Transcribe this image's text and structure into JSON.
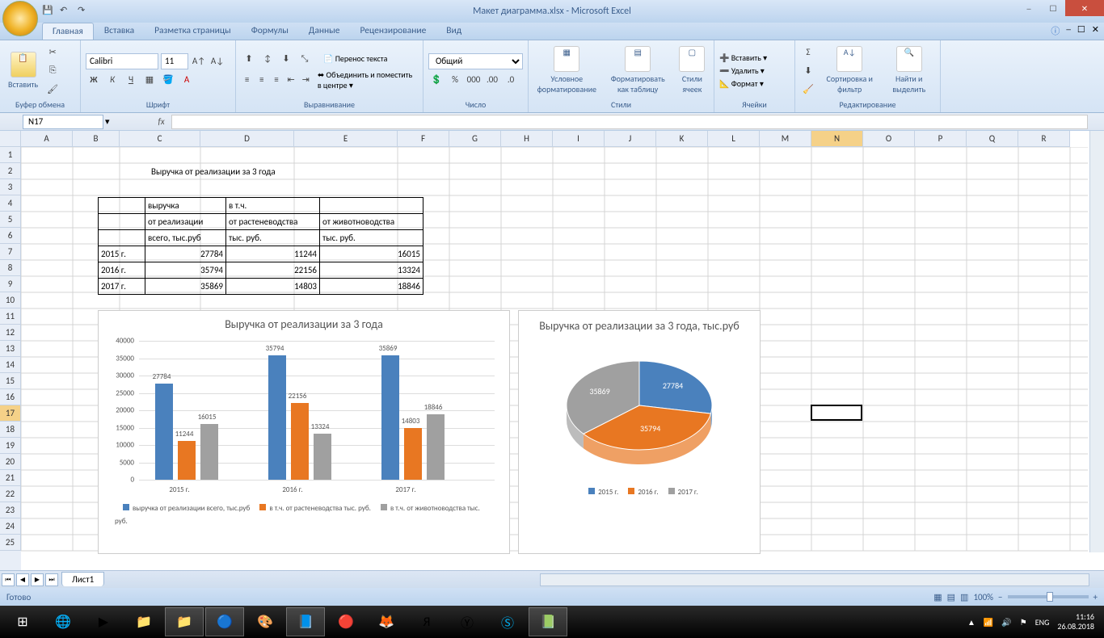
{
  "title": "Макет диаграмма.xlsx - Microsoft Excel",
  "tabs": [
    "Главная",
    "Вставка",
    "Разметка страницы",
    "Формулы",
    "Данные",
    "Рецензирование",
    "Вид"
  ],
  "ribbon": {
    "clipboard": {
      "paste": "Вставить",
      "label": "Буфер обмена"
    },
    "font": {
      "name": "Calibri",
      "size": "11",
      "label": "Шрифт",
      "bold": "Ж",
      "italic": "К",
      "underline": "Ч"
    },
    "align": {
      "wrap": "Перенос текста",
      "merge": "Объединить и поместить в центре",
      "label": "Выравнивание"
    },
    "number": {
      "format": "Общий",
      "label": "Число"
    },
    "styles": {
      "cond": "Условное форматирование",
      "table": "Форматировать как таблицу",
      "cell": "Стили ячеек",
      "label": "Стили"
    },
    "cells": {
      "insert": "Вставить",
      "delete": "Удалить",
      "format": "Формат",
      "label": "Ячейки"
    },
    "editing": {
      "sort": "Сортировка и фильтр",
      "find": "Найти и выделить",
      "label": "Редактирование"
    }
  },
  "namebox": "N17",
  "columns": [
    "A",
    "B",
    "C",
    "D",
    "E",
    "F",
    "G",
    "H",
    "I",
    "J",
    "K",
    "L",
    "M",
    "N",
    "O",
    "P",
    "Q",
    "R"
  ],
  "rows_count": 25,
  "col_widths": {
    "A": 64,
    "B": 58,
    "C": 100,
    "D": 116,
    "E": 128,
    "default": 64
  },
  "table_title": "Выручка от реализации за 3 года",
  "table": {
    "headers": [
      [
        "",
        "выручка",
        "в т.ч.",
        ""
      ],
      [
        "",
        "от реализации",
        "от растеневодства",
        "от животноводства"
      ],
      [
        "",
        "всего, тыс.руб",
        "тыс. руб.",
        "тыс. руб."
      ]
    ],
    "rows": [
      [
        "2015 г.",
        "27784",
        "11244",
        "16015"
      ],
      [
        "2016 г.",
        "35794",
        "22156",
        "13324"
      ],
      [
        "2017 г.",
        "35869",
        "14803",
        "18846"
      ]
    ]
  },
  "chart_data": [
    {
      "type": "bar",
      "title": "Выручка от реализации за 3 года",
      "categories": [
        "2015 г.",
        "2016 г.",
        "2017 г."
      ],
      "series": [
        {
          "name": "выручка  от реализации всего, тыс.руб",
          "values": [
            27784,
            35794,
            35869
          ],
          "color": "#4a81bd"
        },
        {
          "name": "в т.ч. от растеневодства тыс. руб.",
          "values": [
            11244,
            22156,
            14803
          ],
          "color": "#e87722"
        },
        {
          "name": "в т.ч. от животноводства тыс. руб.",
          "values": [
            16015,
            13324,
            18846
          ],
          "color": "#a0a0a0"
        }
      ],
      "ylim": [
        0,
        40000
      ],
      "ytick": 5000
    },
    {
      "type": "pie",
      "title": "Выручка от реализации за 3 года, тыс.руб",
      "categories": [
        "2015 г.",
        "2016 г.",
        "2017 г."
      ],
      "values": [
        27784,
        35794,
        35869
      ],
      "colors": [
        "#4a81bd",
        "#e87722",
        "#a0a0a0"
      ]
    }
  ],
  "sheet_tab": "Лист1",
  "status": "Готово",
  "zoom": "100%",
  "active_cell": "N17",
  "tray": {
    "lang": "ENG",
    "time": "11:16",
    "date": "26.08.2018"
  }
}
